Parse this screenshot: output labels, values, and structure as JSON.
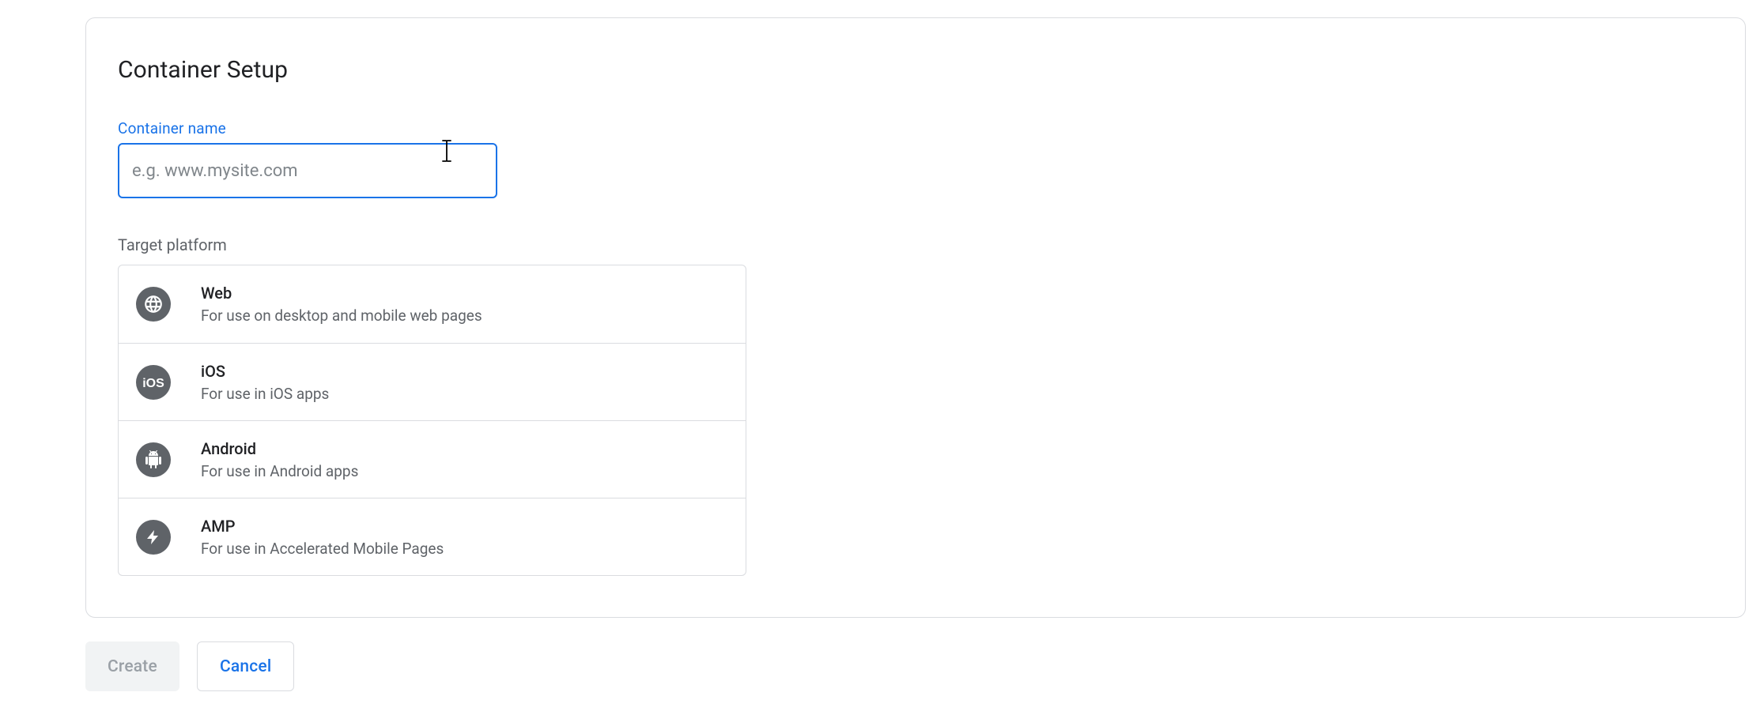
{
  "card": {
    "title": "Container Setup"
  },
  "container_name": {
    "label": "Container name",
    "value": "",
    "placeholder": "e.g. www.mysite.com"
  },
  "target_platform": {
    "label": "Target platform",
    "options": [
      {
        "icon": "globe-icon",
        "title": "Web",
        "desc": "For use on desktop and mobile web pages"
      },
      {
        "icon": "ios-icon",
        "title": "iOS",
        "desc": "For use in iOS apps"
      },
      {
        "icon": "android-icon",
        "title": "Android",
        "desc": "For use in Android apps"
      },
      {
        "icon": "amp-icon",
        "title": "AMP",
        "desc": "For use in Accelerated Mobile Pages"
      }
    ]
  },
  "footer": {
    "create_label": "Create",
    "cancel_label": "Cancel",
    "create_enabled": false
  }
}
